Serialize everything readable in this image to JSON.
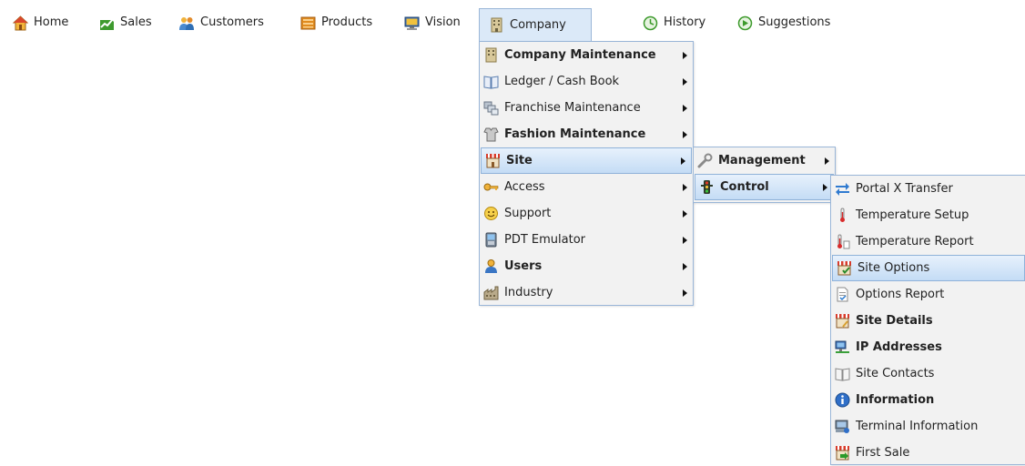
{
  "nav": {
    "home": "Home",
    "sales": "Sales",
    "customers": "Customers",
    "products": "Products",
    "vision": "Vision",
    "company": "Company",
    "history": "History",
    "suggestions": "Suggestions"
  },
  "company_menu": [
    {
      "label": "Company Maintenance",
      "icon": "building-icon"
    },
    {
      "label": "Ledger / Cash Book",
      "icon": "book-icon"
    },
    {
      "label": "Franchise Maintenance",
      "icon": "franchise-icon"
    },
    {
      "label": "Fashion Maintenance",
      "icon": "fashion-icon"
    },
    {
      "label": "Site",
      "icon": "store-icon"
    },
    {
      "label": "Access",
      "icon": "key-icon"
    },
    {
      "label": "Support",
      "icon": "smiley-icon"
    },
    {
      "label": "PDT Emulator",
      "icon": "device-icon"
    },
    {
      "label": "Users",
      "icon": "user-icon"
    },
    {
      "label": "Industry",
      "icon": "factory-icon"
    }
  ],
  "site_menu": [
    {
      "label": "Management",
      "icon": "wrench-icon"
    },
    {
      "label": "Control",
      "icon": "traffic-light-icon"
    }
  ],
  "control_menu": [
    {
      "label": "Portal X Transfer",
      "icon": "transfer-icon"
    },
    {
      "label": "Temperature Setup",
      "icon": "thermometer-icon"
    },
    {
      "label": "Temperature Report",
      "icon": "thermometer-report-icon"
    },
    {
      "label": "Site Options",
      "icon": "store-options-icon"
    },
    {
      "label": "Options Report",
      "icon": "report-icon"
    },
    {
      "label": "Site Details",
      "icon": "store-details-icon"
    },
    {
      "label": "IP Addresses",
      "icon": "network-icon"
    },
    {
      "label": "Site Contacts",
      "icon": "contacts-book-icon"
    },
    {
      "label": "Information",
      "icon": "info-icon"
    },
    {
      "label": "Terminal Information",
      "icon": "terminal-icon"
    },
    {
      "label": "First Sale",
      "icon": "store-sale-icon"
    }
  ],
  "colors": {
    "menu_bg": "#f2f2f2",
    "menu_border": "#9ab6d8",
    "highlight": "#c4dcf5"
  }
}
